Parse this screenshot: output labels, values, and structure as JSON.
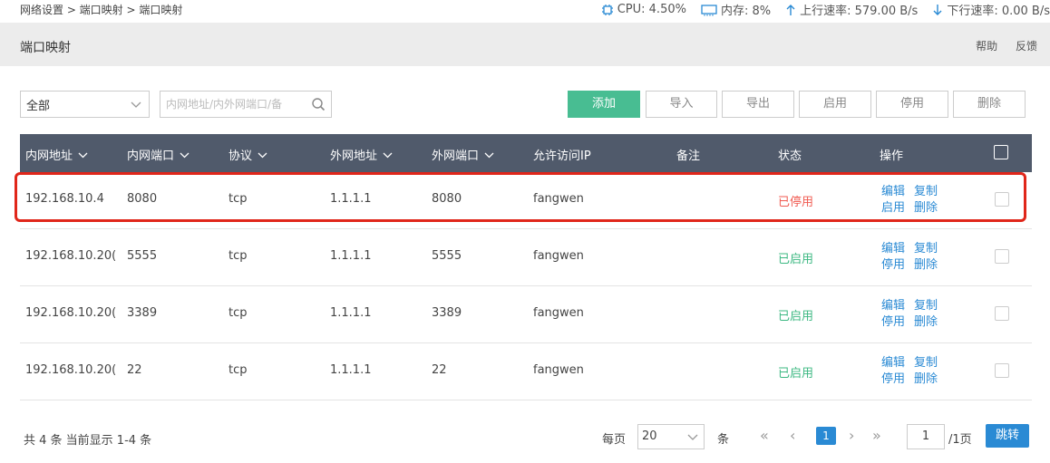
{
  "breadcrumb": "网络设置 > 端口映射 > 端口映射",
  "stats": {
    "cpu": "CPU: 4.50%",
    "memory": "内存: 8%",
    "upload": "上行速率: 579.00 B/s",
    "download": "下行速率: 0.00 B/s"
  },
  "header": {
    "title": "端口映射",
    "help": "帮助",
    "feedback": "反馈"
  },
  "toolbar": {
    "filter_value": "全部",
    "search_placeholder": "内网地址/内外网端口/备",
    "add": "添加",
    "import": "导入",
    "export": "导出",
    "enable": "启用",
    "disable": "停用",
    "delete": "删除"
  },
  "table": {
    "columns": [
      "内网地址",
      "内网端口",
      "协议",
      "外网地址",
      "外网端口",
      "允许访问IP",
      "备注",
      "状态",
      "操作"
    ],
    "rows": [
      {
        "lan_ip": "192.168.10.4",
        "lan_port": "8080",
        "protocol": "tcp",
        "wan_ip": "1.1.1.1",
        "wan_port": "8080",
        "allow_ip": "fangwen",
        "remark": "",
        "status": "已停用",
        "op_edit": "编辑",
        "op_copy": "复制",
        "op_toggle": "启用",
        "op_delete": "删除"
      },
      {
        "lan_ip": "192.168.10.20(",
        "lan_port": "5555",
        "protocol": "tcp",
        "wan_ip": "1.1.1.1",
        "wan_port": "5555",
        "allow_ip": "fangwen",
        "remark": "",
        "status": "已启用",
        "op_edit": "编辑",
        "op_copy": "复制",
        "op_toggle": "停用",
        "op_delete": "删除"
      },
      {
        "lan_ip": "192.168.10.20(",
        "lan_port": "3389",
        "protocol": "tcp",
        "wan_ip": "1.1.1.1",
        "wan_port": "3389",
        "allow_ip": "fangwen",
        "remark": "",
        "status": "已启用",
        "op_edit": "编辑",
        "op_copy": "复制",
        "op_toggle": "停用",
        "op_delete": "删除"
      },
      {
        "lan_ip": "192.168.10.20(",
        "lan_port": "22",
        "protocol": "tcp",
        "wan_ip": "1.1.1.1",
        "wan_port": "22",
        "allow_ip": "fangwen",
        "remark": "",
        "status": "已启用",
        "op_edit": "编辑",
        "op_copy": "复制",
        "op_toggle": "停用",
        "op_delete": "删除"
      }
    ]
  },
  "pagination": {
    "summary": "共 4 条 当前显示 1-4 条",
    "per_page_label": "每页",
    "per_page_value": "20",
    "unit": "条",
    "current_page": "1",
    "page_input": "1",
    "total_pages": "/1页",
    "jump": "跳转"
  },
  "colors": {
    "header_bg": "#505a6b",
    "primary_button": "#48bd92",
    "link": "#2a8ad4",
    "status_disabled": "#f05a50",
    "status_enabled": "#3cb882",
    "highlight": "#e0261a"
  }
}
